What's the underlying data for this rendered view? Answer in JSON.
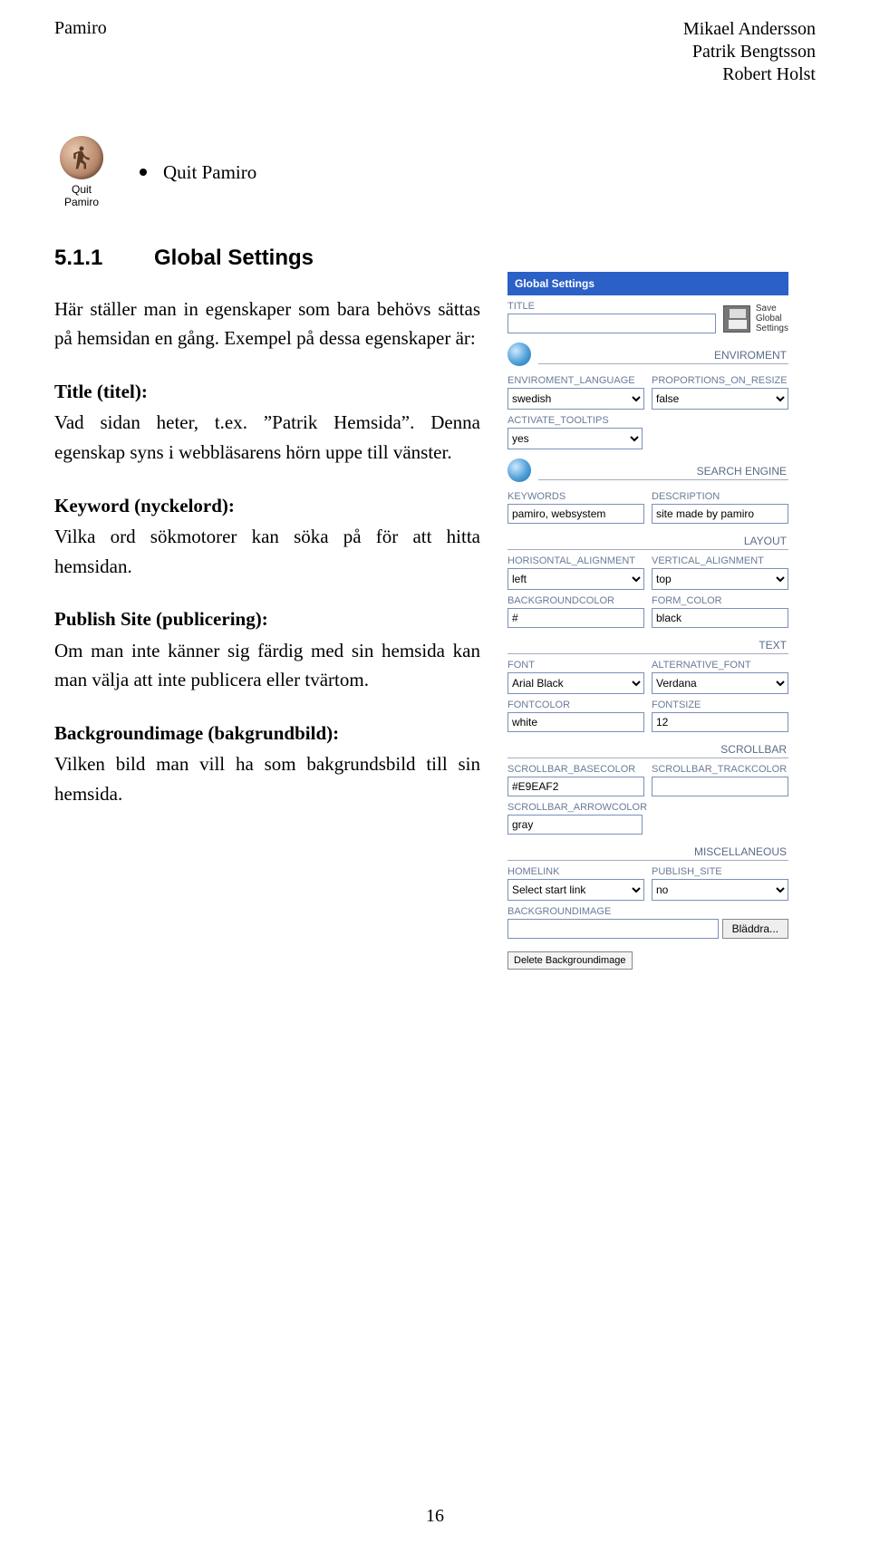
{
  "header": {
    "left": "Pamiro",
    "authors": [
      "Mikael Andersson",
      "Patrik Bengtsson",
      "Robert Holst"
    ]
  },
  "quit": {
    "iconLabelLine1": "Quit",
    "iconLabelLine2": "Pamiro",
    "bullet": "Quit Pamiro"
  },
  "section": {
    "number": "5.1.1",
    "title": "Global Settings"
  },
  "paras": {
    "intro": "Här ställer man in egenskaper som bara behövs sättas på hemsidan en gång. Exempel på dessa egenskaper är:",
    "sub1": "Title (titel):",
    "p1": "Vad sidan heter, t.ex. ”Patrik Hemsida”. Denna egenskap syns i webbläsarens hörn uppe till vänster.",
    "sub2": "Keyword (nyckelord):",
    "p2": "Vilka ord sökmotorer kan söka på för att hitta hemsidan.",
    "sub3": "Publish Site (publicering):",
    "p3": "Om man inte känner sig färdig med sin hemsida kan man välja att inte publicera eller tvärtom.",
    "sub4": "Backgroundimage (bakgrundbild):",
    "p4": "Vilken bild man vill ha som bakgrundsbild till sin hemsida."
  },
  "panel": {
    "title": "Global Settings",
    "saveTxt": "Save\nGlobal\nSettings",
    "envHdr": "ENVIROMENT",
    "searchHdr": "SEARCH ENGINE",
    "layoutHdr": "LAYOUT",
    "textHdr": "TEXT",
    "scrollHdr": "SCROLLBAR",
    "miscHdr": "MISCELLANEOUS",
    "titleLbl": "TITLE",
    "envLangLbl": "ENVIROMENT_LANGUAGE",
    "envLangVal": "swedish",
    "propLbl": "PROPORTIONS_ON_RESIZE",
    "propVal": "false",
    "tooltipLbl": "ACTIVATE_TOOLTIPS",
    "tooltipVal": "yes",
    "kwLbl": "KEYWORDS",
    "kwVal": "pamiro, websystem",
    "descLbl": "DESCRIPTION",
    "descVal": "site made by pamiro",
    "halignLbl": "HORISONTAL_ALIGNMENT",
    "halignVal": "left",
    "valignLbl": "VERTICAL_ALIGNMENT",
    "valignVal": "top",
    "bgLbl": "BACKGROUNDCOLOR",
    "bgVal": "#",
    "formLbl": "FORM_COLOR",
    "formVal": "black",
    "fontLbl": "FONT",
    "fontVal": "Arial Black",
    "altFontLbl": "ALTERNATIVE_FONT",
    "altFontVal": "Verdana",
    "fontColorLbl": "FONTCOLOR",
    "fontColorVal": "white",
    "fontSizeLbl": "FONTSIZE",
    "fontSizeVal": "12",
    "sbBaseLbl": "SCROLLBAR_BASECOLOR",
    "sbBaseVal": "#E9EAF2",
    "sbTrackLbl": "SCROLLBAR_TRACKCOLOR",
    "sbTrackVal": "",
    "sbArrowLbl": "SCROLLBAR_ARROWCOLOR",
    "sbArrowVal": "gray",
    "homeLbl": "HOMELINK",
    "homeVal": "Select start link",
    "pubLbl": "PUBLISH_SITE",
    "pubVal": "no",
    "bgImgLbl": "BACKGROUNDIMAGE",
    "browseLbl": "Bläddra...",
    "delLbl": "Delete Backgroundimage"
  },
  "pageNum": "16"
}
